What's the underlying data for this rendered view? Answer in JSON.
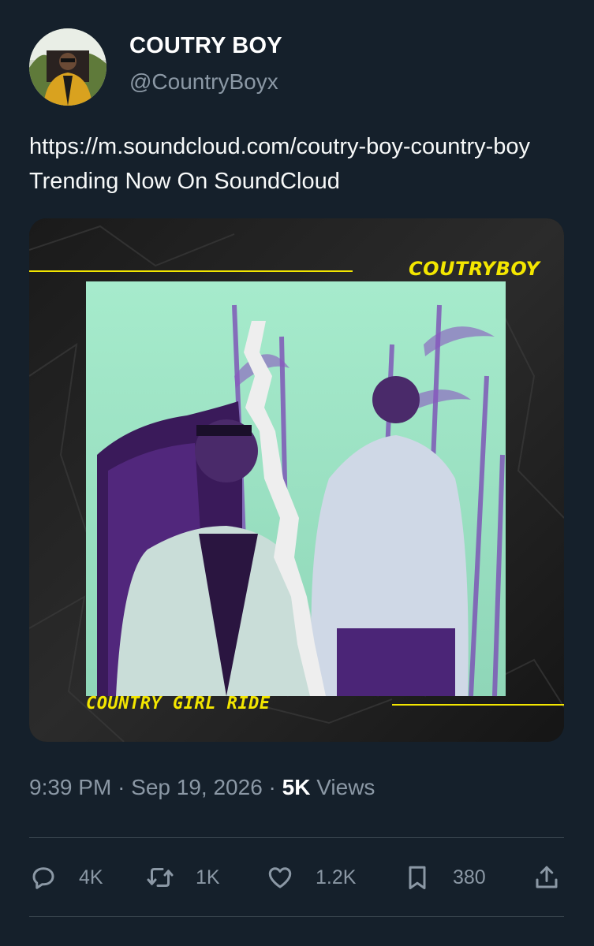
{
  "author": {
    "display_name": "COUTRY BOY",
    "handle": "@CountryBoyx"
  },
  "tweet": {
    "text_before": "https://m.soundcloud.com/coutry-boy-country-boy",
    "text_after": " Trending Now On SoundCloud"
  },
  "media": {
    "cover_top_label": "COUTRYBOY",
    "cover_bottom_label": "COUNTRY GIRL RIDE",
    "accent_color": "#f3e600",
    "tint_color": "#9fe3c4",
    "shadow_color": "#6a2fa0"
  },
  "meta": {
    "time": "9:39 PM",
    "separator": "·",
    "date": "Sep 19, 2026",
    "views_count": "5K",
    "views_label": "Views"
  },
  "actions": {
    "reply": {
      "icon": "reply-icon",
      "count": "4K"
    },
    "retweet": {
      "icon": "retweet-icon",
      "count": "1K"
    },
    "like": {
      "icon": "heart-icon",
      "count": "1.2K"
    },
    "bookmark": {
      "icon": "bookmark-icon",
      "count": "380"
    },
    "share": {
      "icon": "share-icon"
    }
  }
}
